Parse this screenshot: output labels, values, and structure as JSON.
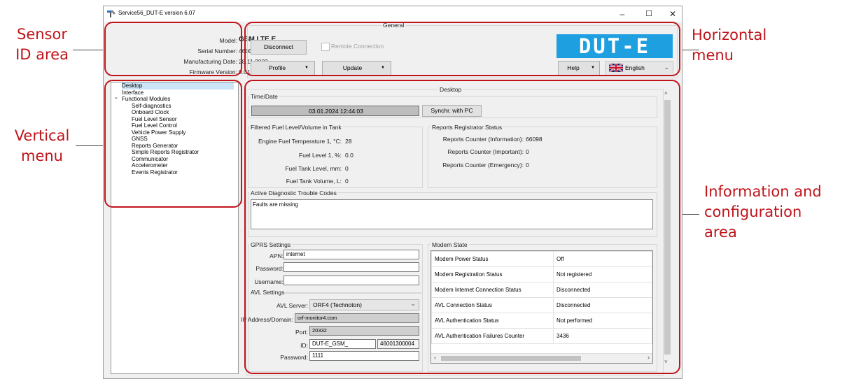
{
  "annotations": {
    "sensor_id": [
      "Sensor",
      "ID area"
    ],
    "vertical_menu": [
      "Vertical",
      "menu"
    ],
    "horizontal_menu": [
      "Horizontal",
      "menu"
    ],
    "info_area": [
      "Information and",
      "configuration",
      "area"
    ]
  },
  "window": {
    "title": "Service56_DUT-E version 6.07",
    "minimize": "–",
    "maximize": "☐",
    "close": "✕"
  },
  "sensor": {
    "model_label": "Model:",
    "model_value": "GSM LTE E",
    "serial_label": "Serial Number:",
    "serial_value": "46001300004",
    "mfg_label": "Manufacturing Date:",
    "mfg_value": "28.11.2023",
    "fw_label": "Firmware Version:",
    "fw_value": "9.01"
  },
  "general": {
    "title": "General",
    "disconnect": "Disconnect",
    "remote_connection": "Remote Connection",
    "profile": "Profile",
    "update": "Update",
    "help": "Help",
    "language": "English",
    "logo": "DUT-E"
  },
  "tree": {
    "items": [
      "Desktop",
      "Interface",
      "Functional Modules"
    ],
    "children": [
      "Self-diagnostics",
      "Onboard Clock",
      "Fuel Level Sensor",
      "Fuel Level Control",
      "Vehicle Power Supply",
      "GNSS",
      "Reports Generator",
      "Simple Reports Registrator",
      "Communicator",
      "Accelerometer",
      "Events Registrator"
    ]
  },
  "desktop": {
    "title": "Desktop",
    "time_group": "Time/Date",
    "datetime": "03.01.2024 12:44:03",
    "sync_button": "Synchr. with PC",
    "fuel_group": "Filtered Fuel Level/Volume in Tank",
    "engine_temp_label": "Engine Fuel Temperature 1, °C:",
    "engine_temp_value": "28",
    "fuel_level_label": "Fuel Level 1, %:",
    "fuel_level_value": "0.0",
    "tank_level_label": "Fuel Tank Level, mm:",
    "tank_level_value": "0",
    "tank_volume_label": "Fuel Tank Volume, L:",
    "tank_volume_value": "0",
    "reports_group": "Reports Registrator Status",
    "rep_info_label": "Reports Counter (Information):",
    "rep_info_value": "66098",
    "rep_imp_label": "Reports Counter (Important):",
    "rep_imp_value": "0",
    "rep_emg_label": "Reports Counter (Emergency):",
    "rep_emg_value": "0",
    "dtc_group": "Active Diagnostic Trouble Codes",
    "dtc_text": "Faults are missing"
  },
  "gprs": {
    "title": "GPRS Settings",
    "apn_label": "APN:",
    "apn_value": "internet",
    "password_label": "Password:",
    "password_value": "",
    "username_label": "Username:",
    "username_value": ""
  },
  "avl": {
    "title": "AVL Settings",
    "server_label": "AVL Server:",
    "server_value": "ORF4 (Technoton)",
    "ip_label": "IP Address/Domain:",
    "ip_value": "orf-monitor4.com",
    "port_label": "Port:",
    "port_value": "20332",
    "id_label": "ID:",
    "id_value": "DUT-E_GSM_",
    "id_suffix": "46001300004",
    "password_label": "Password:",
    "password_value": "1111"
  },
  "modem": {
    "title": "Modem State",
    "rows": [
      {
        "label": "Modem Power Status",
        "value": "Off"
      },
      {
        "label": "Modem Registration Status",
        "value": "Not registered"
      },
      {
        "label": "Modem Internet Connection Status",
        "value": "Disconnected"
      },
      {
        "label": "AVL Connection Status",
        "value": "Disconnected"
      },
      {
        "label": "AVL Authentication Status",
        "value": "Not performed"
      },
      {
        "label": "AVL Authentication Failures Counter",
        "value": "3436"
      }
    ]
  },
  "colors": {
    "annotation": "#c0141b",
    "logo_bg": "#1e9fe0",
    "tree_selected": "#cce4f7"
  }
}
